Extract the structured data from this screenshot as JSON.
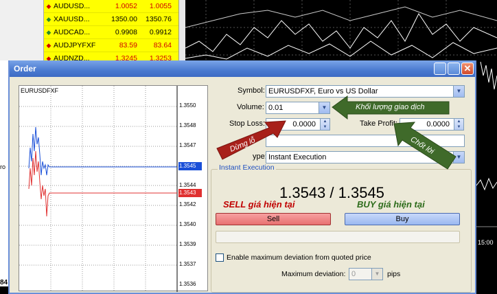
{
  "market_watch": {
    "rows": [
      {
        "symbol": "AUDUSD...",
        "bid": "1.0052",
        "ask": "1.0055",
        "dir": "down"
      },
      {
        "symbol": "XAUUSD...",
        "bid": "1350.00",
        "ask": "1350.76",
        "dir": "up"
      },
      {
        "symbol": "AUDCAD...",
        "bid": "0.9908",
        "ask": "0.9912",
        "dir": "up"
      },
      {
        "symbol": "AUDJPYFXF",
        "bid": "83.59",
        "ask": "83.64",
        "dir": "down"
      },
      {
        "symbol": "AUDNZD...",
        "bid": "1.3245",
        "ask": "1.3253",
        "dir": "down"
      }
    ]
  },
  "background": {
    "left_label": "ro",
    "time_label": "15:00",
    "corner_number": "84"
  },
  "dialog": {
    "title": "Order",
    "close_glyph": "✕",
    "chart": {
      "title": "EURUSDFXF",
      "y_ticks": [
        "1.3550",
        "1.3548",
        "1.3547",
        "1.3545",
        "1.3544",
        "1.3543",
        "1.3542",
        "1.3540",
        "1.3539",
        "1.3537",
        "1.3536"
      ],
      "bid_tag": "1.3545",
      "ask_tag": "1.3543"
    },
    "symbol_label": "Symbol:",
    "symbol_value": "EURUSDFXF, Euro vs US Dollar",
    "volume_label": "Volume:",
    "volume_value": "0.01",
    "stop_loss_label": "Stop Loss:",
    "stop_loss_value": "0.0000",
    "take_profit_label": "Take Profit:",
    "take_profit_value": "0.0000",
    "comment_label": "C",
    "type_label": "ype:",
    "type_value": "Instant Execution",
    "group_title": "Instant Execution",
    "quote": "1.3543 / 1.3545",
    "sell_label": "Sell",
    "buy_label": "Buy",
    "deviation_checkbox_label": "Enable maximum deviation from quoted price",
    "max_deviation_label": "Maximum deviation:",
    "max_deviation_value": "0",
    "pips_label": "pips"
  },
  "annotations": {
    "sell_note": "SELL giá hiện tại",
    "buy_note": "BUY giá hiện tại",
    "volume_arrow": "Khối lượng giao dịch",
    "stoploss_arrow": "Dừng lỗ",
    "takeprofit_arrow": "Chốt lời"
  }
}
